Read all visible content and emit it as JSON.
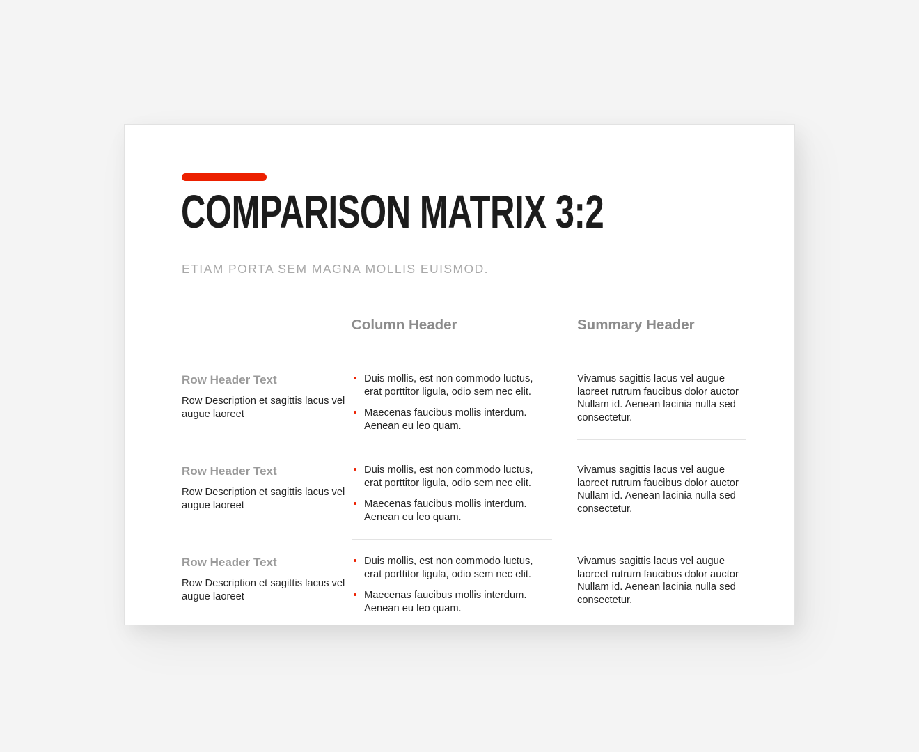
{
  "theme": {
    "accent_color": "#ec2000",
    "title_color": "#1c1c1c",
    "muted_color": "#9a9a9a",
    "body_color": "#262626",
    "canvas_color": "#ffffff",
    "page_background": "#f4f4f4"
  },
  "slide": {
    "title": "COMPARISON MATRIX 3:2",
    "subtitle": "ETIAM PORTA SEM MAGNA MOLLIS EUISMOD."
  },
  "matrix": {
    "headers": {
      "label_column": "",
      "detail_column": "Column Header",
      "summary_column": "Summary Header"
    },
    "rows": [
      {
        "header": "Row Header Text",
        "description": "Row Description et sagittis lacus vel augue laoreet",
        "bullets": [
          "Duis mollis, est non commodo luctus, erat porttitor ligula, odio sem nec elit.",
          "Maecenas faucibus mollis interdum. Aenean eu leo quam."
        ],
        "summary": "Vivamus sagittis lacus vel augue laoreet rutrum faucibus dolor auctor Nullam id. Aenean lacinia nulla sed consectetur."
      },
      {
        "header": "Row Header Text",
        "description": "Row Description et sagittis lacus vel augue laoreet",
        "bullets": [
          "Duis mollis, est non commodo luctus, erat porttitor ligula, odio sem nec elit.",
          "Maecenas faucibus mollis interdum. Aenean eu leo quam."
        ],
        "summary": "Vivamus sagittis lacus vel augue laoreet rutrum faucibus dolor auctor Nullam id. Aenean lacinia nulla sed consectetur."
      },
      {
        "header": "Row Header Text",
        "description": "Row Description et sagittis lacus vel augue laoreet",
        "bullets": [
          "Duis mollis, est non commodo luctus, erat porttitor ligula, odio sem nec elit.",
          "Maecenas faucibus mollis interdum. Aenean eu leo quam."
        ],
        "summary": "Vivamus sagittis lacus vel augue laoreet rutrum faucibus dolor auctor Nullam id. Aenean lacinia nulla sed consectetur."
      }
    ]
  }
}
